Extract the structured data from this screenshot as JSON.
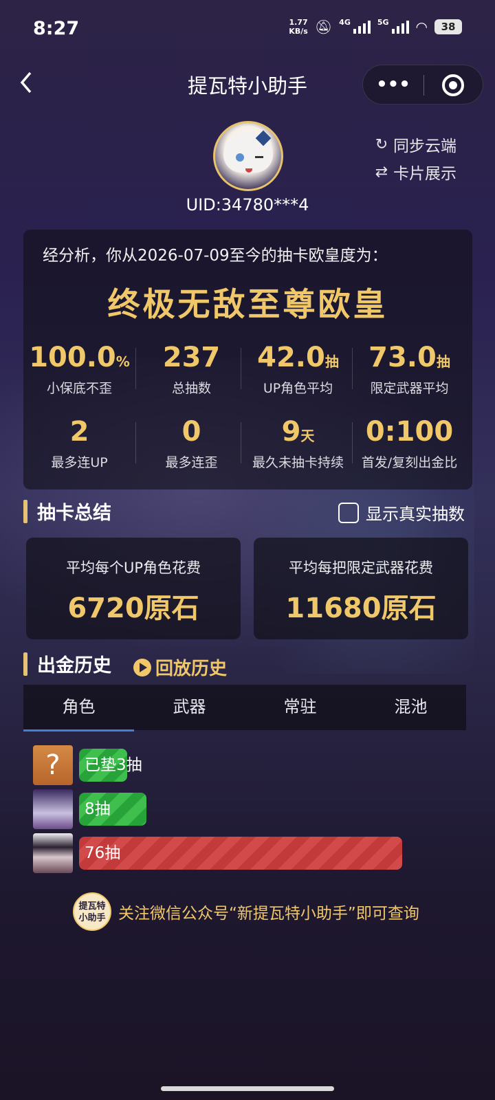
{
  "status": {
    "time": "8:27",
    "speed_top": "1.77",
    "speed_bottom": "KB/s",
    "net1": "4G",
    "net2": "5G",
    "battery": "38"
  },
  "nav": {
    "back_icon": "back-chevron-icon",
    "title": "提瓦特小助手",
    "more_icon": "•••"
  },
  "profile": {
    "uid": "UID:34780***4"
  },
  "actions": {
    "sync_icon": "↻",
    "sync": "同步云端",
    "card_icon": "⇄",
    "card": "卡片展示"
  },
  "analysis": {
    "intro": "经分析，你从2026-07-09至今的抽卡欧皇度为：",
    "rank": "终极无敌至尊欧皇",
    "stats": [
      {
        "value": "100.0",
        "unit": "%",
        "label": "小保底不歪"
      },
      {
        "value": "237",
        "unit": "",
        "label": "总抽数"
      },
      {
        "value": "42.0",
        "unit": "抽",
        "label": "UP角色平均"
      },
      {
        "value": "73.0",
        "unit": "抽",
        "label": "限定武器平均"
      },
      {
        "value": "2",
        "unit": "",
        "label": "最多连UP"
      },
      {
        "value": "0",
        "unit": "",
        "label": "最多连歪"
      },
      {
        "value": "9",
        "unit": "天",
        "label": "最久未抽卡持续"
      },
      {
        "value": "0:100",
        "unit": "",
        "label": "首发/复刻出金比"
      }
    ]
  },
  "summary": {
    "title": "抽卡总结",
    "toggle_label": "显示真实抽数",
    "cards": [
      {
        "title": "平均每个UP角色花费",
        "value": "6720原石"
      },
      {
        "title": "平均每把限定武器花费",
        "value": "11680原石"
      }
    ]
  },
  "history": {
    "title": "出金历史",
    "replay": "回放历史",
    "tabs": [
      "角色",
      "武器",
      "常驻",
      "混池"
    ],
    "active_tab": "角色",
    "items": [
      {
        "label": "已垫3抽",
        "pulls": 3,
        "color": "green",
        "thumb": "?"
      },
      {
        "label": "8抽",
        "pulls": 8,
        "color": "green",
        "thumb": ""
      },
      {
        "label": "76抽",
        "pulls": 76,
        "color": "red",
        "thumb": ""
      }
    ]
  },
  "footer": {
    "logo_line1": "提瓦特",
    "logo_line2": "小助手",
    "text": "关注微信公众号“新提瓦特小助手”即可查询"
  },
  "colors": {
    "gold": "#f0c86a",
    "accent_blue": "#3d80d8",
    "green": "#27a33a",
    "red": "#c33a3a"
  }
}
